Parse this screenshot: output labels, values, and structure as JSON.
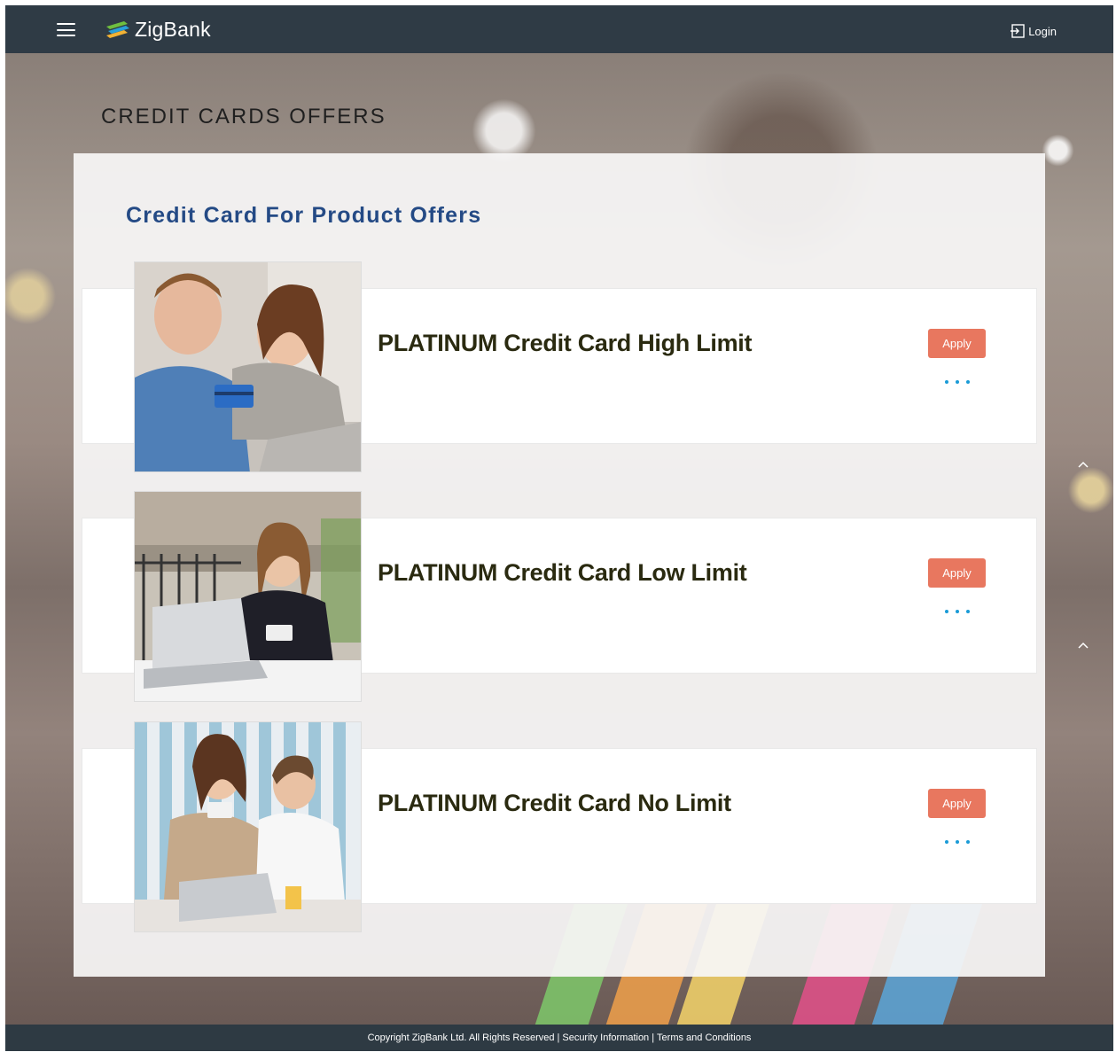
{
  "header": {
    "brand": "ZigBank",
    "login_label": "Login"
  },
  "page": {
    "heading": "CREDIT CARDS OFFERS",
    "section_title": "Credit Card For Product Offers"
  },
  "offers": [
    {
      "title": "PLATINUM Credit Card High Limit",
      "apply_label": "Apply"
    },
    {
      "title": "PLATINUM Credit Card Low Limit",
      "apply_label": "Apply"
    },
    {
      "title": "PLATINUM Credit Card No Limit",
      "apply_label": "Apply"
    }
  ],
  "footer": {
    "copyright": "Copyright ZigBank Ltd. All Rights Reserved",
    "security": "Security Information",
    "terms": "Terms and Conditions",
    "separator": "|"
  },
  "colors": {
    "header_bg": "#2f3b45",
    "section_title": "#244a85",
    "apply_button": "#e8775f",
    "more_dots": "#1a9bd7"
  },
  "icons": [
    "menu-icon",
    "zigbank-logo-icon",
    "login-icon",
    "more-options-icon",
    "chevron-up-icon"
  ]
}
